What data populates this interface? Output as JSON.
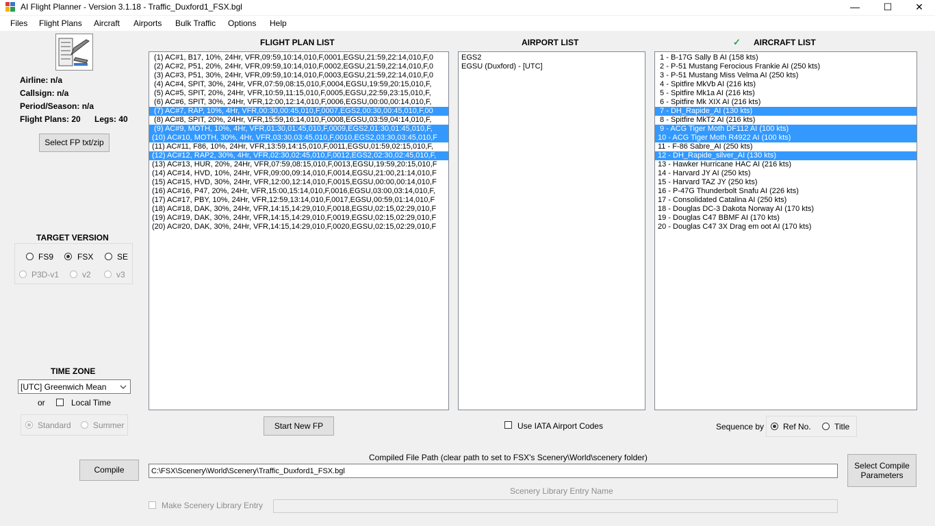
{
  "window": {
    "title": "AI Flight Planner - Version 3.1.18 - Traffic_Duxford1_FSX.bgl",
    "minimize": "—",
    "maximize": "☐",
    "close": "✕"
  },
  "menu": [
    "Files",
    "Flight Plans",
    "Aircraft",
    "Airports",
    "Bulk Traffic",
    "Options",
    "Help"
  ],
  "info": {
    "airline": "Airline: n/a",
    "callsign": "Callsign: n/a",
    "period": "Period/Season: n/a",
    "flight_plans": "Flight Plans: 20",
    "legs": "Legs: 40"
  },
  "select_fp_button": "Select FP txt/zip",
  "target_version": {
    "title": "TARGET VERSION",
    "options": [
      {
        "label": "FS9",
        "checked": false,
        "enabled": true
      },
      {
        "label": "FSX",
        "checked": true,
        "enabled": true
      },
      {
        "label": "SE",
        "checked": false,
        "enabled": true
      },
      {
        "label": "P3D-v1",
        "checked": false,
        "enabled": false
      },
      {
        "label": "v2",
        "checked": false,
        "enabled": false
      },
      {
        "label": "v3",
        "checked": false,
        "enabled": false
      }
    ]
  },
  "time_zone": {
    "title": "TIME ZONE",
    "selected": "[UTC] Greenwich Mean",
    "or_label": "or",
    "local_time_label": "Local Time",
    "local_time_checked": false,
    "standard_label": "Standard",
    "summer_label": "Summer",
    "standard_checked": true
  },
  "flight_plan_list": {
    "title": "FLIGHT PLAN LIST",
    "items": [
      {
        "text": " (1) AC#1, B17, 10%, 24Hr, VFR,09:59,10:14,010,F,0001,EGSU,21:59,22:14,010,F,0",
        "selected": false
      },
      {
        "text": " (2) AC#2, P51, 20%, 24Hr, VFR,09:59,10:14,010,F,0002,EGSU,21:59,22:14,010,F,0",
        "selected": false
      },
      {
        "text": " (3) AC#3, P51, 30%, 24Hr, VFR,09:59,10:14,010,F,0003,EGSU,21:59,22:14,010,F,0",
        "selected": false
      },
      {
        "text": " (4) AC#4, SPIT, 30%, 24Hr, VFR,07:59,08:15,010,F,0004,EGSU,19:59,20:15,010,F,",
        "selected": false
      },
      {
        "text": " (5) AC#5, SPIT, 20%, 24Hr, VFR,10:59,11:15,010,F,0005,EGSU,22:59,23:15,010,F,",
        "selected": false
      },
      {
        "text": " (6) AC#6, SPIT, 30%, 24Hr, VFR,12:00,12:14,010,F,0006,EGSU,00:00,00:14,010,F,",
        "selected": false
      },
      {
        "text": " (7) AC#7, RAP, 10%, 4Hr, VFR,00:30,00:45,010,F,0007,EGS2,00:30,00:45,010,F,00",
        "selected": true
      },
      {
        "text": " (8) AC#8, SPIT, 20%, 24Hr, VFR,15:59,16:14,010,F,0008,EGSU,03:59,04:14,010,F,",
        "selected": false
      },
      {
        "text": " (9) AC#9, MOTH, 10%, 4Hr, VFR,01:30,01:45,010,F,0009,EGS2,01:30,01:45,010,F,",
        "selected": true
      },
      {
        "text": "(10) AC#10, MOTH, 30%, 4Hr, VFR,03:30,03:45,010,F,0010,EGS2,03:30,03:45,010,F",
        "selected": true
      },
      {
        "text": "(11) AC#11, F86, 10%, 24Hr, VFR,13:59,14:15,010,F,0011,EGSU,01:59,02:15,010,F,",
        "selected": false
      },
      {
        "text": "(12) AC#12, RAP2, 30%, 4Hr, VFR,02:30,02:45,010,F,0012,EGS2,02:30,02:45,010,F,",
        "selected": true
      },
      {
        "text": "(13) AC#13, HUR, 20%, 24Hr, VFR,07:59,08:15,010,F,0013,EGSU,19:59,20:15,010,F",
        "selected": false
      },
      {
        "text": "(14) AC#14, HVD, 10%, 24Hr, VFR,09:00,09:14,010,F,0014,EGSU,21:00,21:14,010,F",
        "selected": false
      },
      {
        "text": "(15) AC#15, HVD, 30%, 24Hr, VFR,12:00,12:14,010,F,0015,EGSU,00:00,00:14,010,F",
        "selected": false
      },
      {
        "text": "(16) AC#16, P47, 20%, 24Hr, VFR,15:00,15:14,010,F,0016,EGSU,03:00,03:14,010,F,",
        "selected": false
      },
      {
        "text": "(17) AC#17, PBY, 10%, 24Hr, VFR,12:59,13:14,010,F,0017,EGSU,00:59,01:14,010,F",
        "selected": false
      },
      {
        "text": "(18) AC#18, DAK, 30%, 24Hr, VFR,14:15,14:29,010,F,0018,EGSU,02:15,02:29,010,F",
        "selected": false
      },
      {
        "text": "(19) AC#19, DAK, 30%, 24Hr, VFR,14:15,14:29,010,F,0019,EGSU,02:15,02:29,010,F",
        "selected": false
      },
      {
        "text": "(20) AC#20, DAK, 30%, 24Hr, VFR,14:15,14:29,010,F,0020,EGSU,02:15,02:29,010,F",
        "selected": false
      }
    ]
  },
  "airport_list": {
    "title": "AIRPORT LIST",
    "items": [
      "EGS2",
      "EGSU (Duxford) - [UTC]"
    ]
  },
  "aircraft_list": {
    "title": "AIRCRAFT LIST",
    "check": "✓",
    "items": [
      {
        "text": " 1 - B-17G Sally B AI (158 kts)",
        "selected": false
      },
      {
        "text": " 2 - P-51 Mustang Ferocious Frankie AI (250 kts)",
        "selected": false
      },
      {
        "text": " 3 - P-51 Mustang Miss Velma AI (250 kts)",
        "selected": false
      },
      {
        "text": " 4 - Spitfire MkVb AI (216 kts)",
        "selected": false
      },
      {
        "text": " 5 - Spitfire Mk1a AI (216 kts)",
        "selected": false
      },
      {
        "text": " 6 - Spitfire Mk XIX AI (216 kts)",
        "selected": false
      },
      {
        "text": " 7 - DH_Rapide_AI (130 kts)",
        "selected": true
      },
      {
        "text": " 8 - Spitfire MkT2 AI (216 kts)",
        "selected": false
      },
      {
        "text": " 9 - ACG Tiger Moth DF112 AI (100 kts)",
        "selected": true
      },
      {
        "text": "10 - ACG Tiger Moth R4922 AI (100 kts)",
        "selected": true
      },
      {
        "text": "11 - F-86 Sabre_AI (250 kts)",
        "selected": false
      },
      {
        "text": "12 - DH_Rapide_silver_AI (130 kts)",
        "selected": true
      },
      {
        "text": "13 - Hawker Hurricane HAC AI (216 kts)",
        "selected": false
      },
      {
        "text": "14 - Harvard JY AI (250 kts)",
        "selected": false
      },
      {
        "text": "15 - Harvard TAZ JY (250 kts)",
        "selected": false
      },
      {
        "text": "16 - P-47G Thunderbolt Snafu AI (226 kts)",
        "selected": false
      },
      {
        "text": "17 - Consolidated Catalina AI (250 kts)",
        "selected": false
      },
      {
        "text": "18 - Douglas DC-3 Dakota Norway AI (170 kts)",
        "selected": false
      },
      {
        "text": "19 - Douglas C47 BBMF AI (170 kts)",
        "selected": false
      },
      {
        "text": "20 - Douglas C47 3X Drag em oot AI (170 kts)",
        "selected": false
      }
    ]
  },
  "start_new_fp_button": "Start New FP",
  "use_iata_label": "Use IATA Airport Codes",
  "use_iata_checked": false,
  "sequence": {
    "label": "Sequence by",
    "ref_label": "Ref No.",
    "title_label": "Title",
    "ref_checked": true
  },
  "compile_button": "Compile",
  "compiled_path_label": "Compiled File Path (clear path to set to FSX's Scenery\\World\\scenery folder)",
  "compiled_path_value": "C:\\FSX\\Scenery\\World\\Scenery\\Traffic_Duxford1_FSX.bgl",
  "select_compile_params_button": "Select Compile Parameters",
  "scenery_library_label": "Scenery Library Entry Name",
  "make_scenery_label": "Make Scenery Library Entry",
  "colors": {
    "selection": "#3399ff",
    "window_bg": "#f0f0f0"
  }
}
